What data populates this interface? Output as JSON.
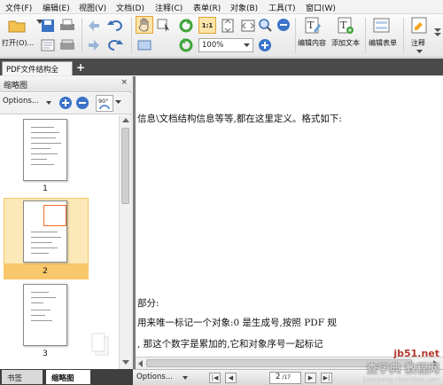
{
  "menubar": {
    "items": [
      "文件(F)",
      "编辑(E)",
      "视图(V)",
      "文档(D)",
      "注释(C)",
      "表单(R)",
      "对象(B)",
      "工具(T)",
      "窗口(W)"
    ]
  },
  "toolbar": {
    "open_label": "打开(O)...",
    "zoom_value": "100%",
    "zoom_fit_label": "1:1",
    "edit_content_label": "编辑内容",
    "add_text_label": "添加文本",
    "edit_form_label": "编辑表单",
    "annotate_label": "注释"
  },
  "tabs": {
    "doc_tab": "PDF文件结构全",
    "add_tab": "+"
  },
  "panel": {
    "title": "缩略图",
    "close": "×",
    "options_label": "Options...",
    "rotate_label": "90°",
    "pages": [
      "1",
      "2",
      "3"
    ]
  },
  "bottom_tabs": {
    "bookmarks": "书签",
    "thumbnails": "缩略图"
  },
  "document": {
    "lines": [
      "信息\\文档结构信息等等,都在这里定义。格式如下:",
      "部分:",
      "用来唯一标记一个对象:0 是生成号,按照 PDF 规",
      ", 那这个数字是累加的,它和对象序号一起标记"
    ]
  },
  "statusbar": {
    "options_label": "Options...",
    "page_current": "2",
    "page_total": "17"
  },
  "watermark": {
    "site": "jb51.net",
    "text": "查字典 教程网",
    "url": "jiaocheng.chazidian.com"
  },
  "colors": {
    "accent": "#f5a623",
    "selection": "#fde9b8",
    "tabbar": "#4a4a4a"
  }
}
